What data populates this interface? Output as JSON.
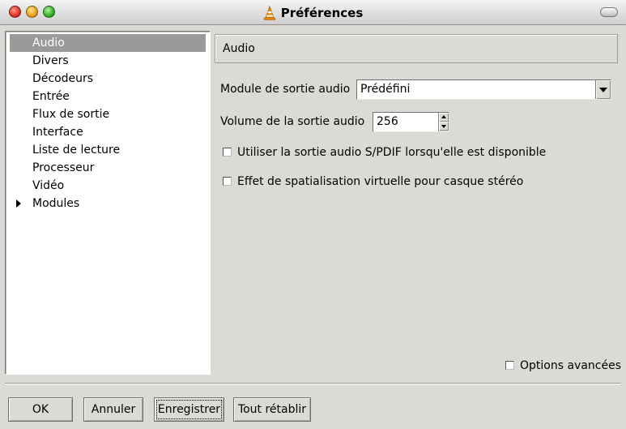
{
  "window": {
    "title": "Préférences"
  },
  "categories": [
    {
      "label": "Audio",
      "selected": true
    },
    {
      "label": "Divers"
    },
    {
      "label": "Décodeurs"
    },
    {
      "label": "Entrée"
    },
    {
      "label": "Flux de sortie"
    },
    {
      "label": "Interface"
    },
    {
      "label": "Liste de lecture"
    },
    {
      "label": "Processeur"
    },
    {
      "label": "Vidéo"
    },
    {
      "label": "Modules",
      "expandable": true
    }
  ],
  "section": {
    "title": "Audio"
  },
  "settings": {
    "output_module": {
      "label": "Module de sortie audio",
      "value": "Prédéfini"
    },
    "volume": {
      "label": "Volume de la sortie audio",
      "value": "256"
    },
    "spdif": {
      "label": "Utiliser la sortie audio S/PDIF lorsqu'elle est disponible",
      "checked": false
    },
    "spatialization": {
      "label": "Effet de spatialisation virtuelle pour casque stéréo",
      "checked": false
    }
  },
  "advanced_options": {
    "label": "Options avancées",
    "checked": false
  },
  "buttons": {
    "ok": "OK",
    "cancel": "Annuler",
    "save": "Enregistrer",
    "reset": "Tout rétablir"
  },
  "icons": {
    "close": "close-icon",
    "minimize": "minimize-icon",
    "maximize": "maximize-icon",
    "app": "vlc-cone-icon",
    "toolbar_toggle": "toolbar-toggle-icon",
    "expand": "triangle-right-icon"
  },
  "colors": {
    "selection": "#9b9a98",
    "window_bg": "#dcdad5",
    "cone_orange": "#f08a00"
  }
}
